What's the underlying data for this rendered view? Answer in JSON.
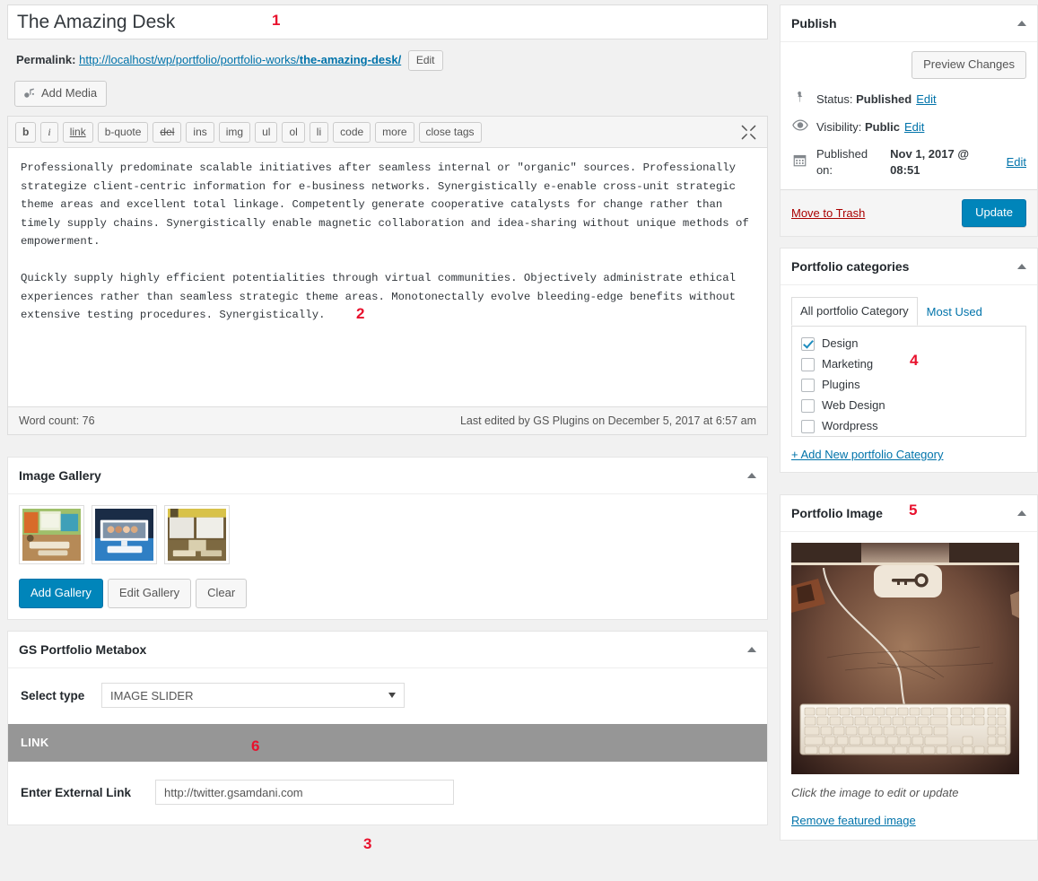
{
  "post": {
    "title": "The Amazing Desk",
    "permalink_label": "Permalink:",
    "permalink_prefix": "http://localhost/wp/portfolio/portfolio-works/",
    "permalink_slug": "the-amazing-desk/",
    "permalink_edit_button": "Edit",
    "add_media_button": "Add Media"
  },
  "editor": {
    "toolbar_buttons": [
      "b",
      "i",
      "link",
      "b-quote",
      "del",
      "ins",
      "img",
      "ul",
      "ol",
      "li",
      "code",
      "more",
      "close tags"
    ],
    "fullscreen_icon": "fullscreen-icon",
    "content": "Professionally predominate scalable initiatives after seamless internal or \"organic\" sources. Professionally strategize client-centric information for e-business networks. Synergistically e-enable cross-unit strategic theme areas and excellent total linkage. Competently generate cooperative catalysts for change rather than timely supply chains. Synergistically enable magnetic collaboration and idea-sharing without unique methods of empowerment.\n\nQuickly supply highly efficient potentialities through virtual communities. Objectively administrate ethical experiences rather than seamless strategic theme areas. Monotonectally evolve bleeding-edge benefits without extensive testing procedures. Synergistically.",
    "word_count": "Word count: 76",
    "last_edited": "Last edited by GS Plugins on December 5, 2017 at 6:57 am"
  },
  "publish": {
    "title": "Publish",
    "preview_button": "Preview Changes",
    "status_icon": "pin-icon",
    "status_label": "Status:",
    "status_value": "Published",
    "status_edit": "Edit",
    "visibility_icon": "eye-icon",
    "visibility_label": "Visibility:",
    "visibility_value": "Public",
    "visibility_edit": "Edit",
    "published_icon": "calendar-icon",
    "published_label": "Published on:",
    "published_value": "Nov 1, 2017 @ 08:51",
    "published_edit": "Edit",
    "trash_link": "Move to Trash",
    "update_button": "Update",
    "accent_color": "#0085ba",
    "trash_color": "#a00"
  },
  "categories": {
    "title": "Portfolio categories",
    "tabs": [
      {
        "label": "All portfolio Category",
        "active": true
      },
      {
        "label": "Most Used",
        "active": false
      }
    ],
    "items": [
      {
        "label": "Design",
        "checked": true
      },
      {
        "label": "Marketing",
        "checked": false
      },
      {
        "label": "Plugins",
        "checked": false
      },
      {
        "label": "Web Design",
        "checked": false
      },
      {
        "label": "Wordpress",
        "checked": false
      }
    ],
    "add_new": "+ Add New portfolio Category"
  },
  "featured": {
    "title": "Portfolio Image",
    "caption": "Click the image to edit or update",
    "remove_link": "Remove featured image"
  },
  "gallery": {
    "title": "Image Gallery",
    "thumbnails": [
      "desk-monitor-thumbnail",
      "widescreen-monitor-thumbnail",
      "office-desk-thumbnail"
    ],
    "add_button": "Add Gallery",
    "edit_button": "Edit Gallery",
    "clear_button": "Clear"
  },
  "metabox": {
    "title": "GS Portfolio Metabox",
    "select_label": "Select type",
    "select_value": "IMAGE SLIDER",
    "link_section_title": "LINK",
    "external_link_label": "Enter External Link",
    "external_link_value": "http://twitter.gsamdani.com"
  },
  "markers": {
    "m1": "1",
    "m2": "2",
    "m3": "3",
    "m4": "4",
    "m5": "5",
    "m6": "6",
    "color": "#e8112d"
  }
}
